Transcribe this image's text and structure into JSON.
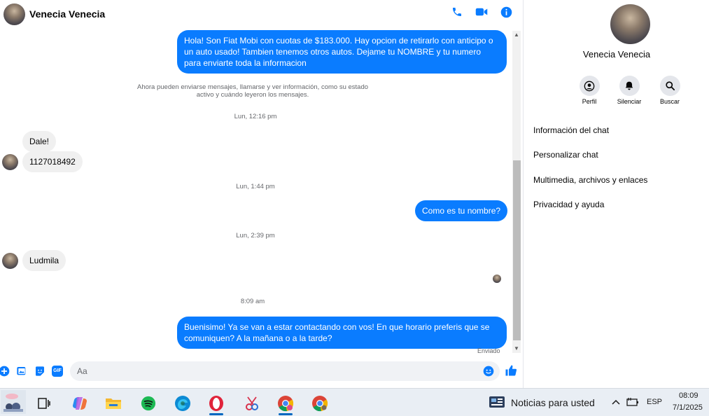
{
  "header": {
    "contact_name": "Venecia Venecia",
    "actions": [
      "phone-icon",
      "video-icon",
      "info-icon"
    ]
  },
  "messages": {
    "m1": "Hola! Son Fiat Mobi con cuotas de $183.000. Hay opcion de retirarlo con anticipo o un auto usado! Tambien tenemos otros autos. Dejame tu NOMBRE y tu numero para enviarte toda la informacion",
    "system_notice": "Ahora pueden enviarse mensajes, llamarse y ver información, como su estado activo y cuándo leyeron los mensajes.",
    "ts1": "Lun, 12:16 pm",
    "m2": "Dale!",
    "m3": "1127018492",
    "ts2": "Lun, 1:44 pm",
    "m4": "Como es tu nombre?",
    "ts3": "Lun, 2:39 pm",
    "m5": "Ludmila",
    "ts4": "8:09 am",
    "m6": "Buenisimo! Ya se van a estar contactando con vos! En que horario preferis que se comuniquen? A la mañana o a la tarde?",
    "status": "Enviado"
  },
  "composer": {
    "placeholder": "Aa",
    "icons": [
      "plus-icon",
      "image-icon",
      "sticker-icon",
      "gif-icon",
      "emoji-icon",
      "like-icon"
    ],
    "gif_label": "GIF"
  },
  "info_panel": {
    "name": "Venecia Venecia",
    "actions": [
      "Perfil",
      "Silenciar",
      "Buscar"
    ],
    "menu": [
      "Información del chat",
      "Personalizar chat",
      "Multimedia, archivos y enlaces",
      "Privacidad y ayuda"
    ]
  },
  "taskbar": {
    "news": "Noticias para usted",
    "lang": "ESP",
    "time": "08:09",
    "date": "7/1/2025",
    "apps": [
      "widgets-icon",
      "task-view-icon",
      "copilot-icon",
      "file-explorer-icon",
      "spotify-icon",
      "edge-icon",
      "opera-icon",
      "snipping-icon",
      "chrome-icon",
      "chrome-alt-icon"
    ]
  },
  "colors": {
    "accent": "#0a7cff",
    "incoming": "#f0f0f0",
    "taskbar": "#e9eef4"
  }
}
